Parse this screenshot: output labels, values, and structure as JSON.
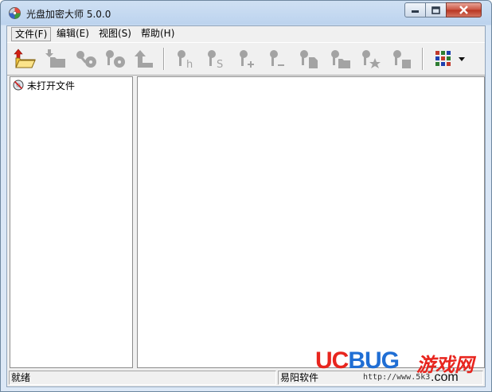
{
  "window": {
    "title": "光盘加密大师 5.0.0"
  },
  "menu": [
    {
      "label": "文件(F)"
    },
    {
      "label": "编辑(E)"
    },
    {
      "label": "视图(S)"
    },
    {
      "label": "帮助(H)"
    }
  ],
  "toolbar": {
    "buttons": [
      {
        "icon": "open-folder-icon",
        "enabled": true
      },
      {
        "icon": "save-folder-icon",
        "enabled": false
      },
      {
        "icon": "key-disc-icon",
        "enabled": false
      },
      {
        "icon": "key-disc-alt-icon",
        "enabled": false
      },
      {
        "icon": "up-level-icon",
        "enabled": false
      },
      {
        "icon": "key-hide-icon",
        "enabled": false
      },
      {
        "icon": "key-s-icon",
        "enabled": false
      },
      {
        "icon": "key-plus-icon",
        "enabled": false
      },
      {
        "icon": "key-minus-icon",
        "enabled": false
      },
      {
        "icon": "key-file-icon",
        "enabled": false
      },
      {
        "icon": "key-folder-icon",
        "enabled": false
      },
      {
        "icon": "key-star-icon",
        "enabled": false
      },
      {
        "icon": "key-block-icon",
        "enabled": false
      },
      {
        "icon": "view-grid-icon",
        "enabled": true
      }
    ]
  },
  "tree": {
    "root_label": "未打开文件"
  },
  "status": {
    "left": "就绪",
    "right": "易阳软件"
  },
  "watermark": {
    "uc": "UC",
    "bug": "BUG",
    "cn": "游戏网",
    "url": "http://www.5k3",
    "com": ".com"
  },
  "colors": {
    "disabled_icon": "#a3a3a3",
    "accent_red": "#e8251e",
    "accent_blue": "#1f6ed4"
  }
}
